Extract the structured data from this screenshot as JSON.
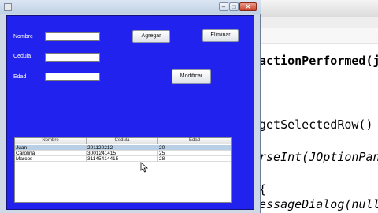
{
  "editor": {
    "lines": [
      "actionPerformed(j",
      "getSelectedRow()",
      "rseInt(JOptionPan",
      "{",
      "essageDialog(null"
    ]
  },
  "window": {
    "controls": {
      "minimize": "–",
      "maximize": "□",
      "close": "✕"
    }
  },
  "form": {
    "nombre_label": "Nombre",
    "cedula_label": "Cedula",
    "edad_label": "Edad",
    "nombre_value": "",
    "cedula_value": "",
    "edad_value": ""
  },
  "buttons": {
    "agregar": "Agregar",
    "eliminar": "Eliminar",
    "modificar": "Modificar"
  },
  "table": {
    "headers": [
      "Nombre",
      "Cedula",
      "Edad"
    ],
    "rows": [
      [
        "Juan",
        "201120212",
        "20"
      ],
      [
        "Carolina",
        "3001241415",
        "25"
      ],
      [
        "Marcos",
        "31145414415",
        "28"
      ]
    ],
    "selected_row": 0
  },
  "colors": {
    "panel_background": "#2222ee",
    "selection": "#b8cfe5"
  }
}
